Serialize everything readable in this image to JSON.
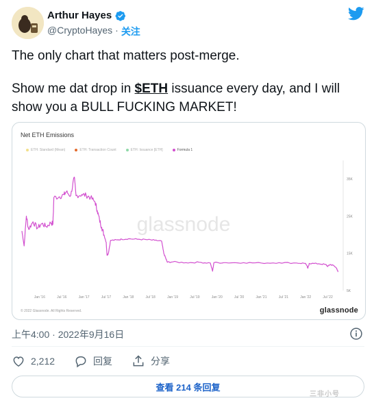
{
  "author": {
    "name": "Arthur Hayes",
    "handle": "@CryptoHayes",
    "separator": "·",
    "follow_label": "关注"
  },
  "tweet": {
    "line1": "The only chart that matters post-merge.",
    "line2_pre": "Show me dat drop in ",
    "cashtag": "$ETH",
    "line2_post": " issuance every day, and I will show you a BULL FUCKING MARKET!"
  },
  "chart_card": {
    "watermark": "glassnode",
    "copyright": "© 2022 Glassnode. All Rights Reserved.",
    "brand": "glassnode"
  },
  "chart_data": {
    "type": "line",
    "title": "Net ETH Emissions",
    "legend": [
      {
        "label": "ETH: Standard (Mean)",
        "color": "#f2e08a",
        "active": false
      },
      {
        "label": "ETH: Transaction Count",
        "color": "#e36b2c",
        "active": false
      },
      {
        "label": "ETH: Issuance [ETH]",
        "color": "#8fd9a8",
        "active": false
      },
      {
        "label": "Formula 1",
        "color": "#d24fcf",
        "active": true
      }
    ],
    "x_ticks": [
      "Jan '16",
      "Jul '16",
      "Jan '17",
      "Jul '17",
      "Jan '18",
      "Jul '18",
      "Jan '19",
      "Jul '19",
      "Jan '20",
      "Jul '20",
      "Jan '21",
      "Jul '21",
      "Jan '22",
      "Jul '22"
    ],
    "y_ticks": [
      "5K",
      "15K",
      "25K",
      "35K"
    ],
    "ylim": [
      5000,
      40000
    ],
    "xlim": [
      2015.6,
      2022.8
    ],
    "series": [
      {
        "color": "#d24fcf",
        "points": [
          [
            2015.6,
            21000
          ],
          [
            2015.65,
            17000
          ],
          [
            2015.7,
            25000
          ],
          [
            2015.75,
            21500
          ],
          [
            2015.85,
            23500
          ],
          [
            2015.95,
            21800
          ],
          [
            2016.05,
            23000
          ],
          [
            2016.15,
            22200
          ],
          [
            2016.25,
            23200
          ],
          [
            2016.3,
            23000
          ],
          [
            2016.32,
            30000
          ],
          [
            2016.45,
            30200
          ],
          [
            2016.55,
            30800
          ],
          [
            2016.6,
            31500
          ],
          [
            2016.7,
            30500
          ],
          [
            2016.78,
            35500
          ],
          [
            2016.82,
            30500
          ],
          [
            2016.95,
            30800
          ],
          [
            2017.05,
            30600
          ],
          [
            2017.15,
            30000
          ],
          [
            2017.25,
            28800
          ],
          [
            2017.3,
            26500
          ],
          [
            2017.35,
            24000
          ],
          [
            2017.4,
            22000
          ],
          [
            2017.45,
            20000
          ],
          [
            2017.5,
            18000
          ],
          [
            2017.52,
            14500
          ],
          [
            2017.55,
            15000
          ],
          [
            2017.6,
            18500
          ],
          [
            2017.75,
            18600
          ],
          [
            2017.85,
            18800
          ],
          [
            2018.0,
            18900
          ],
          [
            2018.2,
            18800
          ],
          [
            2018.4,
            18700
          ],
          [
            2018.6,
            18500
          ],
          [
            2018.75,
            18300
          ],
          [
            2018.8,
            15000
          ],
          [
            2018.85,
            13500
          ],
          [
            2018.88,
            12600
          ],
          [
            2019.0,
            12700
          ],
          [
            2019.3,
            12500
          ],
          [
            2019.6,
            12600
          ],
          [
            2019.85,
            12400
          ],
          [
            2019.9,
            10200
          ],
          [
            2019.93,
            12500
          ],
          [
            2020.2,
            12500
          ],
          [
            2020.6,
            12500
          ],
          [
            2021.0,
            12400
          ],
          [
            2021.4,
            12500
          ],
          [
            2021.8,
            12400
          ],
          [
            2022.0,
            12300
          ],
          [
            2022.05,
            11000
          ],
          [
            2022.08,
            12300
          ],
          [
            2022.3,
            12200
          ],
          [
            2022.45,
            12000
          ],
          [
            2022.5,
            11500
          ],
          [
            2022.55,
            12000
          ],
          [
            2022.62,
            11800
          ],
          [
            2022.7,
            11000
          ],
          [
            2022.73,
            10000
          ]
        ]
      }
    ]
  },
  "meta": {
    "timestamp": "上午4:00 · 2022年9月16日"
  },
  "actions": {
    "likes_count": "2,212",
    "reply_label": "回复",
    "share_label": "分享"
  },
  "replies_button": {
    "label": "查看 214 条回复"
  },
  "footer_watermark": "三非小号"
}
